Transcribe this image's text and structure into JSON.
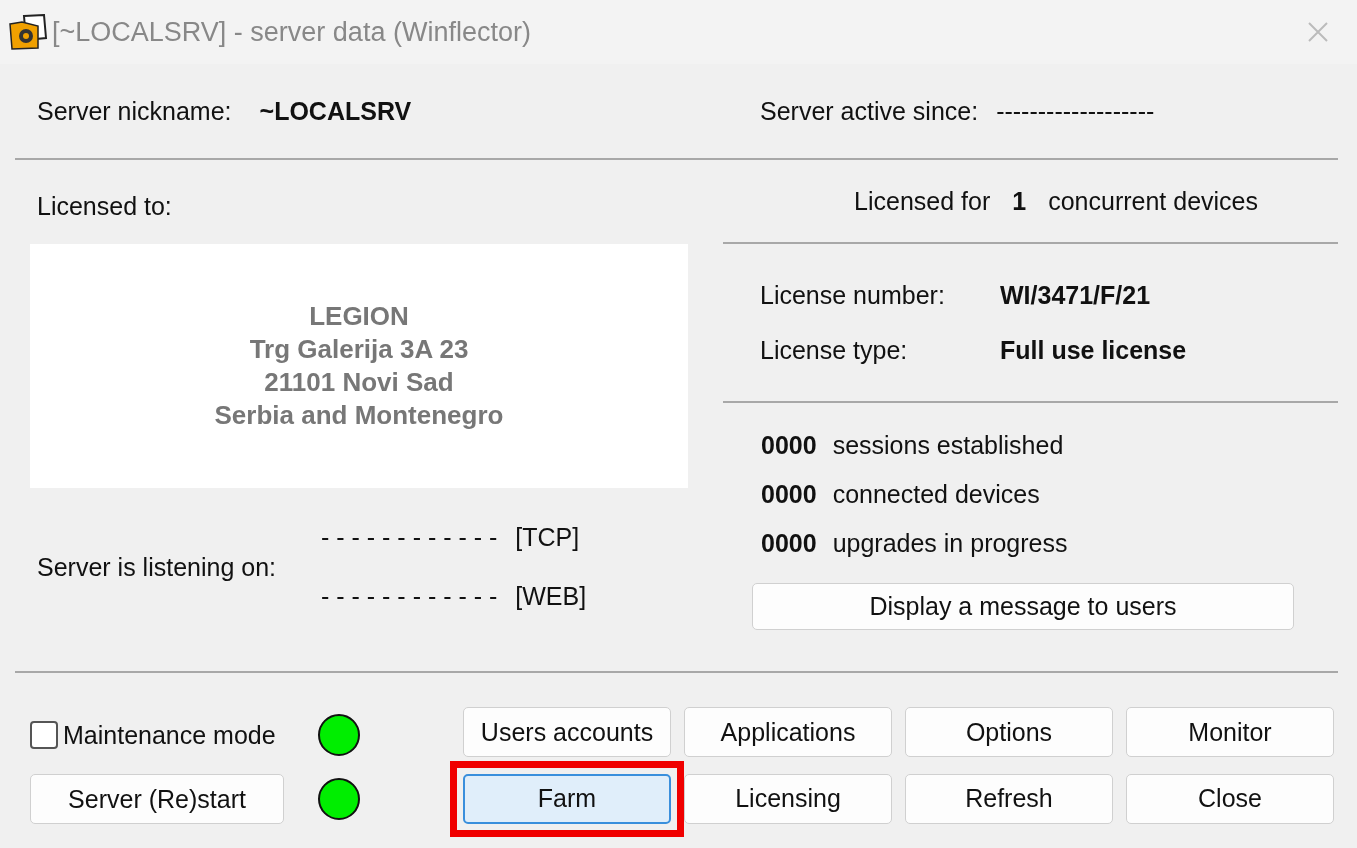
{
  "window": {
    "title": "[~LOCALSRV] - server data (Winflector)"
  },
  "server": {
    "nickname_label": "Server nickname:",
    "nickname": "~LOCALSRV",
    "active_label": "Server active since:",
    "active_value": "-------------------"
  },
  "licensee": {
    "label": "Licensed to:",
    "lines": [
      "LEGION",
      "Trg Galerija 3A 23",
      "21101 Novi Sad",
      "Serbia and Montenegro"
    ]
  },
  "listening": {
    "label": "Server is listening on:",
    "entries": [
      {
        "value": "- - - - - - - - - - - -",
        "protocol": "[TCP]"
      },
      {
        "value": "- - - - - - - - - - - -",
        "protocol": "[WEB]"
      }
    ]
  },
  "license": {
    "for_prefix": "Licensed for",
    "count": "1",
    "for_suffix": "concurrent devices",
    "fields": [
      {
        "label": "License number:",
        "value": "WI/3471/F/21"
      },
      {
        "label": "License type:",
        "value": "Full use license"
      }
    ]
  },
  "stats": [
    {
      "count": "0000",
      "label": "sessions established"
    },
    {
      "count": "0000",
      "label": "connected devices"
    },
    {
      "count": "0000",
      "label": "upgrades in progress"
    }
  ],
  "message_button": "Display a message to users",
  "maintenance": {
    "label": "Maintenance mode",
    "checked": false,
    "color": "#00ee00"
  },
  "restart": {
    "label": "Server (Re)start",
    "color": "#00ee00"
  },
  "buttons": [
    {
      "label": "Users accounts",
      "selected": false,
      "highlighted": false
    },
    {
      "label": "Applications",
      "selected": false,
      "highlighted": false
    },
    {
      "label": "Options",
      "selected": false,
      "highlighted": false
    },
    {
      "label": "Monitor",
      "selected": false,
      "highlighted": false
    },
    {
      "label": "Farm",
      "selected": true,
      "highlighted": true
    },
    {
      "label": "Licensing",
      "selected": false,
      "highlighted": false
    },
    {
      "label": "Refresh",
      "selected": false,
      "highlighted": false
    },
    {
      "label": "Close",
      "selected": false,
      "highlighted": false
    }
  ]
}
